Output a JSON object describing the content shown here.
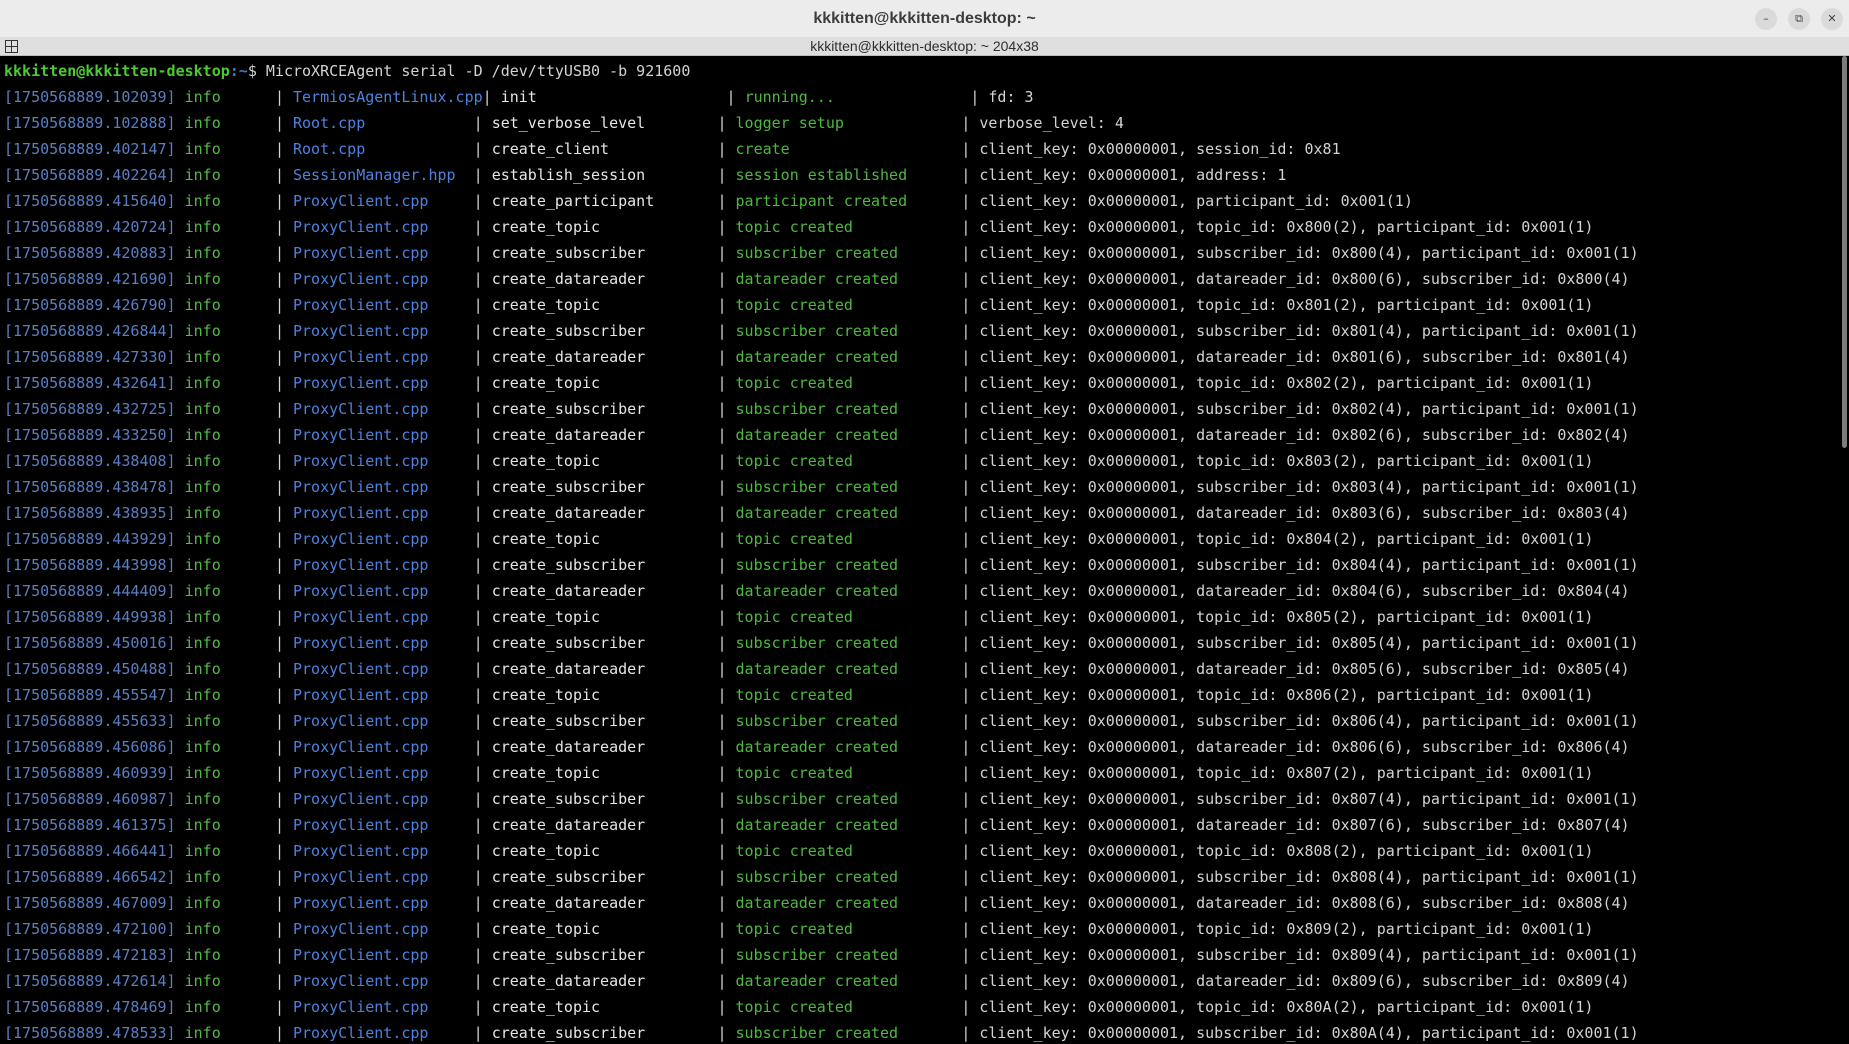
{
  "window": {
    "title": "kkkitten@kkkitten-desktop: ~",
    "tab_title": "kkkitten@kkkitten-desktop: ~ 204x38",
    "minimize_glyph": "–",
    "maximize_glyph": "⧉",
    "close_glyph": "✕",
    "icons": [
      "tab-menu-icon",
      "minimize-icon",
      "maximize-icon",
      "close-icon"
    ]
  },
  "colors": {
    "prompt_user": "#4ec934",
    "prompt_path": "#3b78d6",
    "timestamp": "#5b7fc4",
    "level": "#55b84a",
    "source": "#4d82e0",
    "action": "#4fb840",
    "text": "#d3d3d3"
  },
  "terminal": {
    "prompt_user": "kkkitten@kkkitten-desktop",
    "prompt_path": ":~",
    "prompt_sign": "$",
    "command": "MicroXRCEAgent serial -D /dev/ttyUSB0 -b 921600",
    "lines": [
      {
        "ts": "[1750568889.102039]",
        "level": "info",
        "src": "TermiosAgentLinux.cpp",
        "fn": "init",
        "action": "running...",
        "detail": "fd: 3"
      },
      {
        "ts": "[1750568889.102888]",
        "level": "info",
        "src": "Root.cpp",
        "fn": "set_verbose_level",
        "action": "logger setup",
        "detail": "verbose_level: 4"
      },
      {
        "ts": "[1750568889.402147]",
        "level": "info",
        "src": "Root.cpp",
        "fn": "create_client",
        "action": "create",
        "detail": "client_key: 0x00000001, session_id: 0x81"
      },
      {
        "ts": "[1750568889.402264]",
        "level": "info",
        "src": "SessionManager.hpp",
        "fn": "establish_session",
        "action": "session established",
        "detail": "client_key: 0x00000001, address: 1"
      },
      {
        "ts": "[1750568889.415640]",
        "level": "info",
        "src": "ProxyClient.cpp",
        "fn": "create_participant",
        "action": "participant created",
        "detail": "client_key: 0x00000001, participant_id: 0x001(1)"
      },
      {
        "ts": "[1750568889.420724]",
        "level": "info",
        "src": "ProxyClient.cpp",
        "fn": "create_topic",
        "action": "topic created",
        "detail": "client_key: 0x00000001, topic_id: 0x800(2), participant_id: 0x001(1)"
      },
      {
        "ts": "[1750568889.420883]",
        "level": "info",
        "src": "ProxyClient.cpp",
        "fn": "create_subscriber",
        "action": "subscriber created",
        "detail": "client_key: 0x00000001, subscriber_id: 0x800(4), participant_id: 0x001(1)"
      },
      {
        "ts": "[1750568889.421690]",
        "level": "info",
        "src": "ProxyClient.cpp",
        "fn": "create_datareader",
        "action": "datareader created",
        "detail": "client_key: 0x00000001, datareader_id: 0x800(6), subscriber_id: 0x800(4)"
      },
      {
        "ts": "[1750568889.426790]",
        "level": "info",
        "src": "ProxyClient.cpp",
        "fn": "create_topic",
        "action": "topic created",
        "detail": "client_key: 0x00000001, topic_id: 0x801(2), participant_id: 0x001(1)"
      },
      {
        "ts": "[1750568889.426844]",
        "level": "info",
        "src": "ProxyClient.cpp",
        "fn": "create_subscriber",
        "action": "subscriber created",
        "detail": "client_key: 0x00000001, subscriber_id: 0x801(4), participant_id: 0x001(1)"
      },
      {
        "ts": "[1750568889.427330]",
        "level": "info",
        "src": "ProxyClient.cpp",
        "fn": "create_datareader",
        "action": "datareader created",
        "detail": "client_key: 0x00000001, datareader_id: 0x801(6), subscriber_id: 0x801(4)"
      },
      {
        "ts": "[1750568889.432641]",
        "level": "info",
        "src": "ProxyClient.cpp",
        "fn": "create_topic",
        "action": "topic created",
        "detail": "client_key: 0x00000001, topic_id: 0x802(2), participant_id: 0x001(1)"
      },
      {
        "ts": "[1750568889.432725]",
        "level": "info",
        "src": "ProxyClient.cpp",
        "fn": "create_subscriber",
        "action": "subscriber created",
        "detail": "client_key: 0x00000001, subscriber_id: 0x802(4), participant_id: 0x001(1)"
      },
      {
        "ts": "[1750568889.433250]",
        "level": "info",
        "src": "ProxyClient.cpp",
        "fn": "create_datareader",
        "action": "datareader created",
        "detail": "client_key: 0x00000001, datareader_id: 0x802(6), subscriber_id: 0x802(4)"
      },
      {
        "ts": "[1750568889.438408]",
        "level": "info",
        "src": "ProxyClient.cpp",
        "fn": "create_topic",
        "action": "topic created",
        "detail": "client_key: 0x00000001, topic_id: 0x803(2), participant_id: 0x001(1)"
      },
      {
        "ts": "[1750568889.438478]",
        "level": "info",
        "src": "ProxyClient.cpp",
        "fn": "create_subscriber",
        "action": "subscriber created",
        "detail": "client_key: 0x00000001, subscriber_id: 0x803(4), participant_id: 0x001(1)"
      },
      {
        "ts": "[1750568889.438935]",
        "level": "info",
        "src": "ProxyClient.cpp",
        "fn": "create_datareader",
        "action": "datareader created",
        "detail": "client_key: 0x00000001, datareader_id: 0x803(6), subscriber_id: 0x803(4)"
      },
      {
        "ts": "[1750568889.443929]",
        "level": "info",
        "src": "ProxyClient.cpp",
        "fn": "create_topic",
        "action": "topic created",
        "detail": "client_key: 0x00000001, topic_id: 0x804(2), participant_id: 0x001(1)"
      },
      {
        "ts": "[1750568889.443998]",
        "level": "info",
        "src": "ProxyClient.cpp",
        "fn": "create_subscriber",
        "action": "subscriber created",
        "detail": "client_key: 0x00000001, subscriber_id: 0x804(4), participant_id: 0x001(1)"
      },
      {
        "ts": "[1750568889.444409]",
        "level": "info",
        "src": "ProxyClient.cpp",
        "fn": "create_datareader",
        "action": "datareader created",
        "detail": "client_key: 0x00000001, datareader_id: 0x804(6), subscriber_id: 0x804(4)"
      },
      {
        "ts": "[1750568889.449938]",
        "level": "info",
        "src": "ProxyClient.cpp",
        "fn": "create_topic",
        "action": "topic created",
        "detail": "client_key: 0x00000001, topic_id: 0x805(2), participant_id: 0x001(1)"
      },
      {
        "ts": "[1750568889.450016]",
        "level": "info",
        "src": "ProxyClient.cpp",
        "fn": "create_subscriber",
        "action": "subscriber created",
        "detail": "client_key: 0x00000001, subscriber_id: 0x805(4), participant_id: 0x001(1)"
      },
      {
        "ts": "[1750568889.450488]",
        "level": "info",
        "src": "ProxyClient.cpp",
        "fn": "create_datareader",
        "action": "datareader created",
        "detail": "client_key: 0x00000001, datareader_id: 0x805(6), subscriber_id: 0x805(4)"
      },
      {
        "ts": "[1750568889.455547]",
        "level": "info",
        "src": "ProxyClient.cpp",
        "fn": "create_topic",
        "action": "topic created",
        "detail": "client_key: 0x00000001, topic_id: 0x806(2), participant_id: 0x001(1)"
      },
      {
        "ts": "[1750568889.455633]",
        "level": "info",
        "src": "ProxyClient.cpp",
        "fn": "create_subscriber",
        "action": "subscriber created",
        "detail": "client_key: 0x00000001, subscriber_id: 0x806(4), participant_id: 0x001(1)"
      },
      {
        "ts": "[1750568889.456086]",
        "level": "info",
        "src": "ProxyClient.cpp",
        "fn": "create_datareader",
        "action": "datareader created",
        "detail": "client_key: 0x00000001, datareader_id: 0x806(6), subscriber_id: 0x806(4)"
      },
      {
        "ts": "[1750568889.460939]",
        "level": "info",
        "src": "ProxyClient.cpp",
        "fn": "create_topic",
        "action": "topic created",
        "detail": "client_key: 0x00000001, topic_id: 0x807(2), participant_id: 0x001(1)"
      },
      {
        "ts": "[1750568889.460987]",
        "level": "info",
        "src": "ProxyClient.cpp",
        "fn": "create_subscriber",
        "action": "subscriber created",
        "detail": "client_key: 0x00000001, subscriber_id: 0x807(4), participant_id: 0x001(1)"
      },
      {
        "ts": "[1750568889.461375]",
        "level": "info",
        "src": "ProxyClient.cpp",
        "fn": "create_datareader",
        "action": "datareader created",
        "detail": "client_key: 0x00000001, datareader_id: 0x807(6), subscriber_id: 0x807(4)"
      },
      {
        "ts": "[1750568889.466441]",
        "level": "info",
        "src": "ProxyClient.cpp",
        "fn": "create_topic",
        "action": "topic created",
        "detail": "client_key: 0x00000001, topic_id: 0x808(2), participant_id: 0x001(1)"
      },
      {
        "ts": "[1750568889.466542]",
        "level": "info",
        "src": "ProxyClient.cpp",
        "fn": "create_subscriber",
        "action": "subscriber created",
        "detail": "client_key: 0x00000001, subscriber_id: 0x808(4), participant_id: 0x001(1)"
      },
      {
        "ts": "[1750568889.467009]",
        "level": "info",
        "src": "ProxyClient.cpp",
        "fn": "create_datareader",
        "action": "datareader created",
        "detail": "client_key: 0x00000001, datareader_id: 0x808(6), subscriber_id: 0x808(4)"
      },
      {
        "ts": "[1750568889.472100]",
        "level": "info",
        "src": "ProxyClient.cpp",
        "fn": "create_topic",
        "action": "topic created",
        "detail": "client_key: 0x00000001, topic_id: 0x809(2), participant_id: 0x001(1)"
      },
      {
        "ts": "[1750568889.472183]",
        "level": "info",
        "src": "ProxyClient.cpp",
        "fn": "create_subscriber",
        "action": "subscriber created",
        "detail": "client_key: 0x00000001, subscriber_id: 0x809(4), participant_id: 0x001(1)"
      },
      {
        "ts": "[1750568889.472614]",
        "level": "info",
        "src": "ProxyClient.cpp",
        "fn": "create_datareader",
        "action": "datareader created",
        "detail": "client_key: 0x00000001, datareader_id: 0x809(6), subscriber_id: 0x809(4)"
      },
      {
        "ts": "[1750568889.478469]",
        "level": "info",
        "src": "ProxyClient.cpp",
        "fn": "create_topic",
        "action": "topic created",
        "detail": "client_key: 0x00000001, topic_id: 0x80A(2), participant_id: 0x001(1)"
      },
      {
        "ts": "[1750568889.478533]",
        "level": "info",
        "src": "ProxyClient.cpp",
        "fn": "create_subscriber",
        "action": "subscriber created",
        "detail": "client_key: 0x00000001, subscriber_id: 0x80A(4), participant_id: 0x001(1)"
      }
    ]
  }
}
